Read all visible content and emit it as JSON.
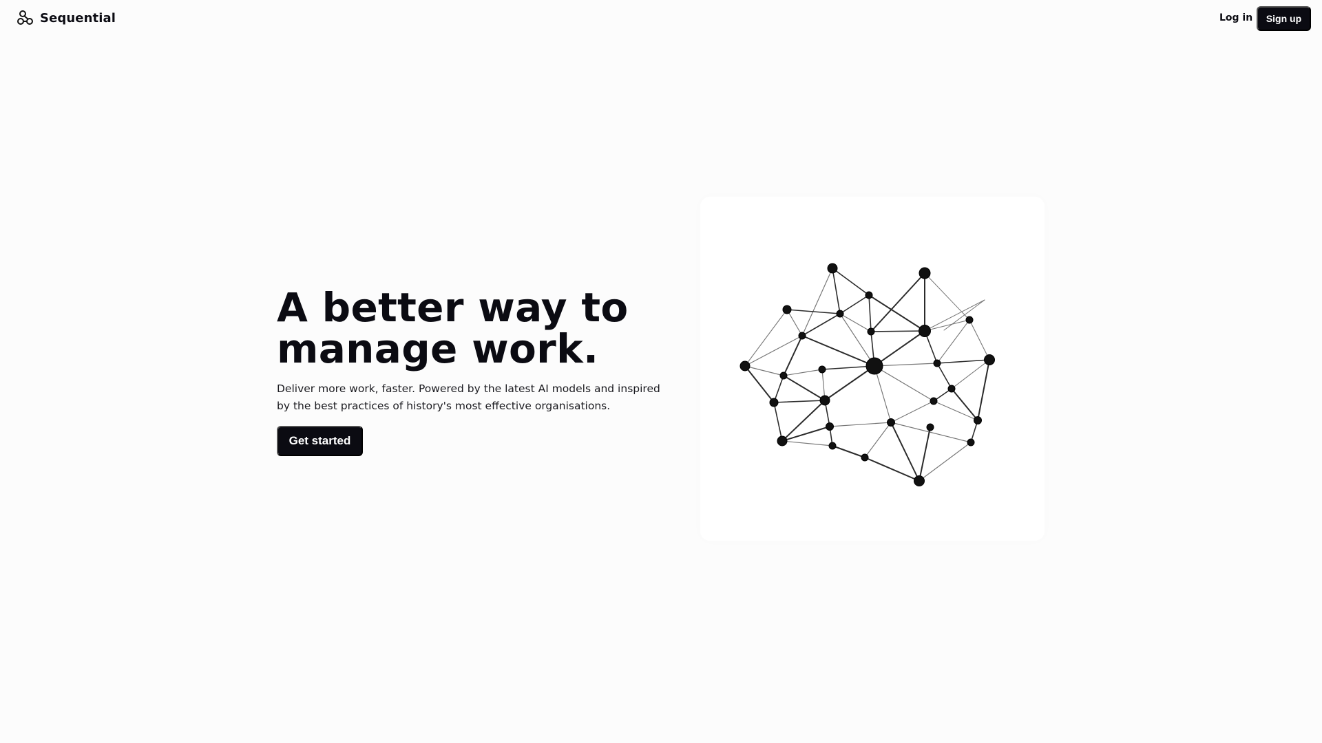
{
  "header": {
    "brand_name": "Sequential",
    "login_label": "Log in",
    "signup_label": "Sign up"
  },
  "hero": {
    "title_line_1": "A better way to",
    "title_line_2": "manage work.",
    "subtitle": "Deliver more work, faster. Powered by the latest AI models and inspired by the best practices of history's most effective organisations.",
    "cta_label": "Get started"
  },
  "colors": {
    "background": "#fcfcfc",
    "primary": "#0b0b12",
    "button_text": "#ffffff"
  },
  "icons": {
    "brand_icon": "network-logo-icon",
    "illustration": "network-graph-illustration"
  }
}
